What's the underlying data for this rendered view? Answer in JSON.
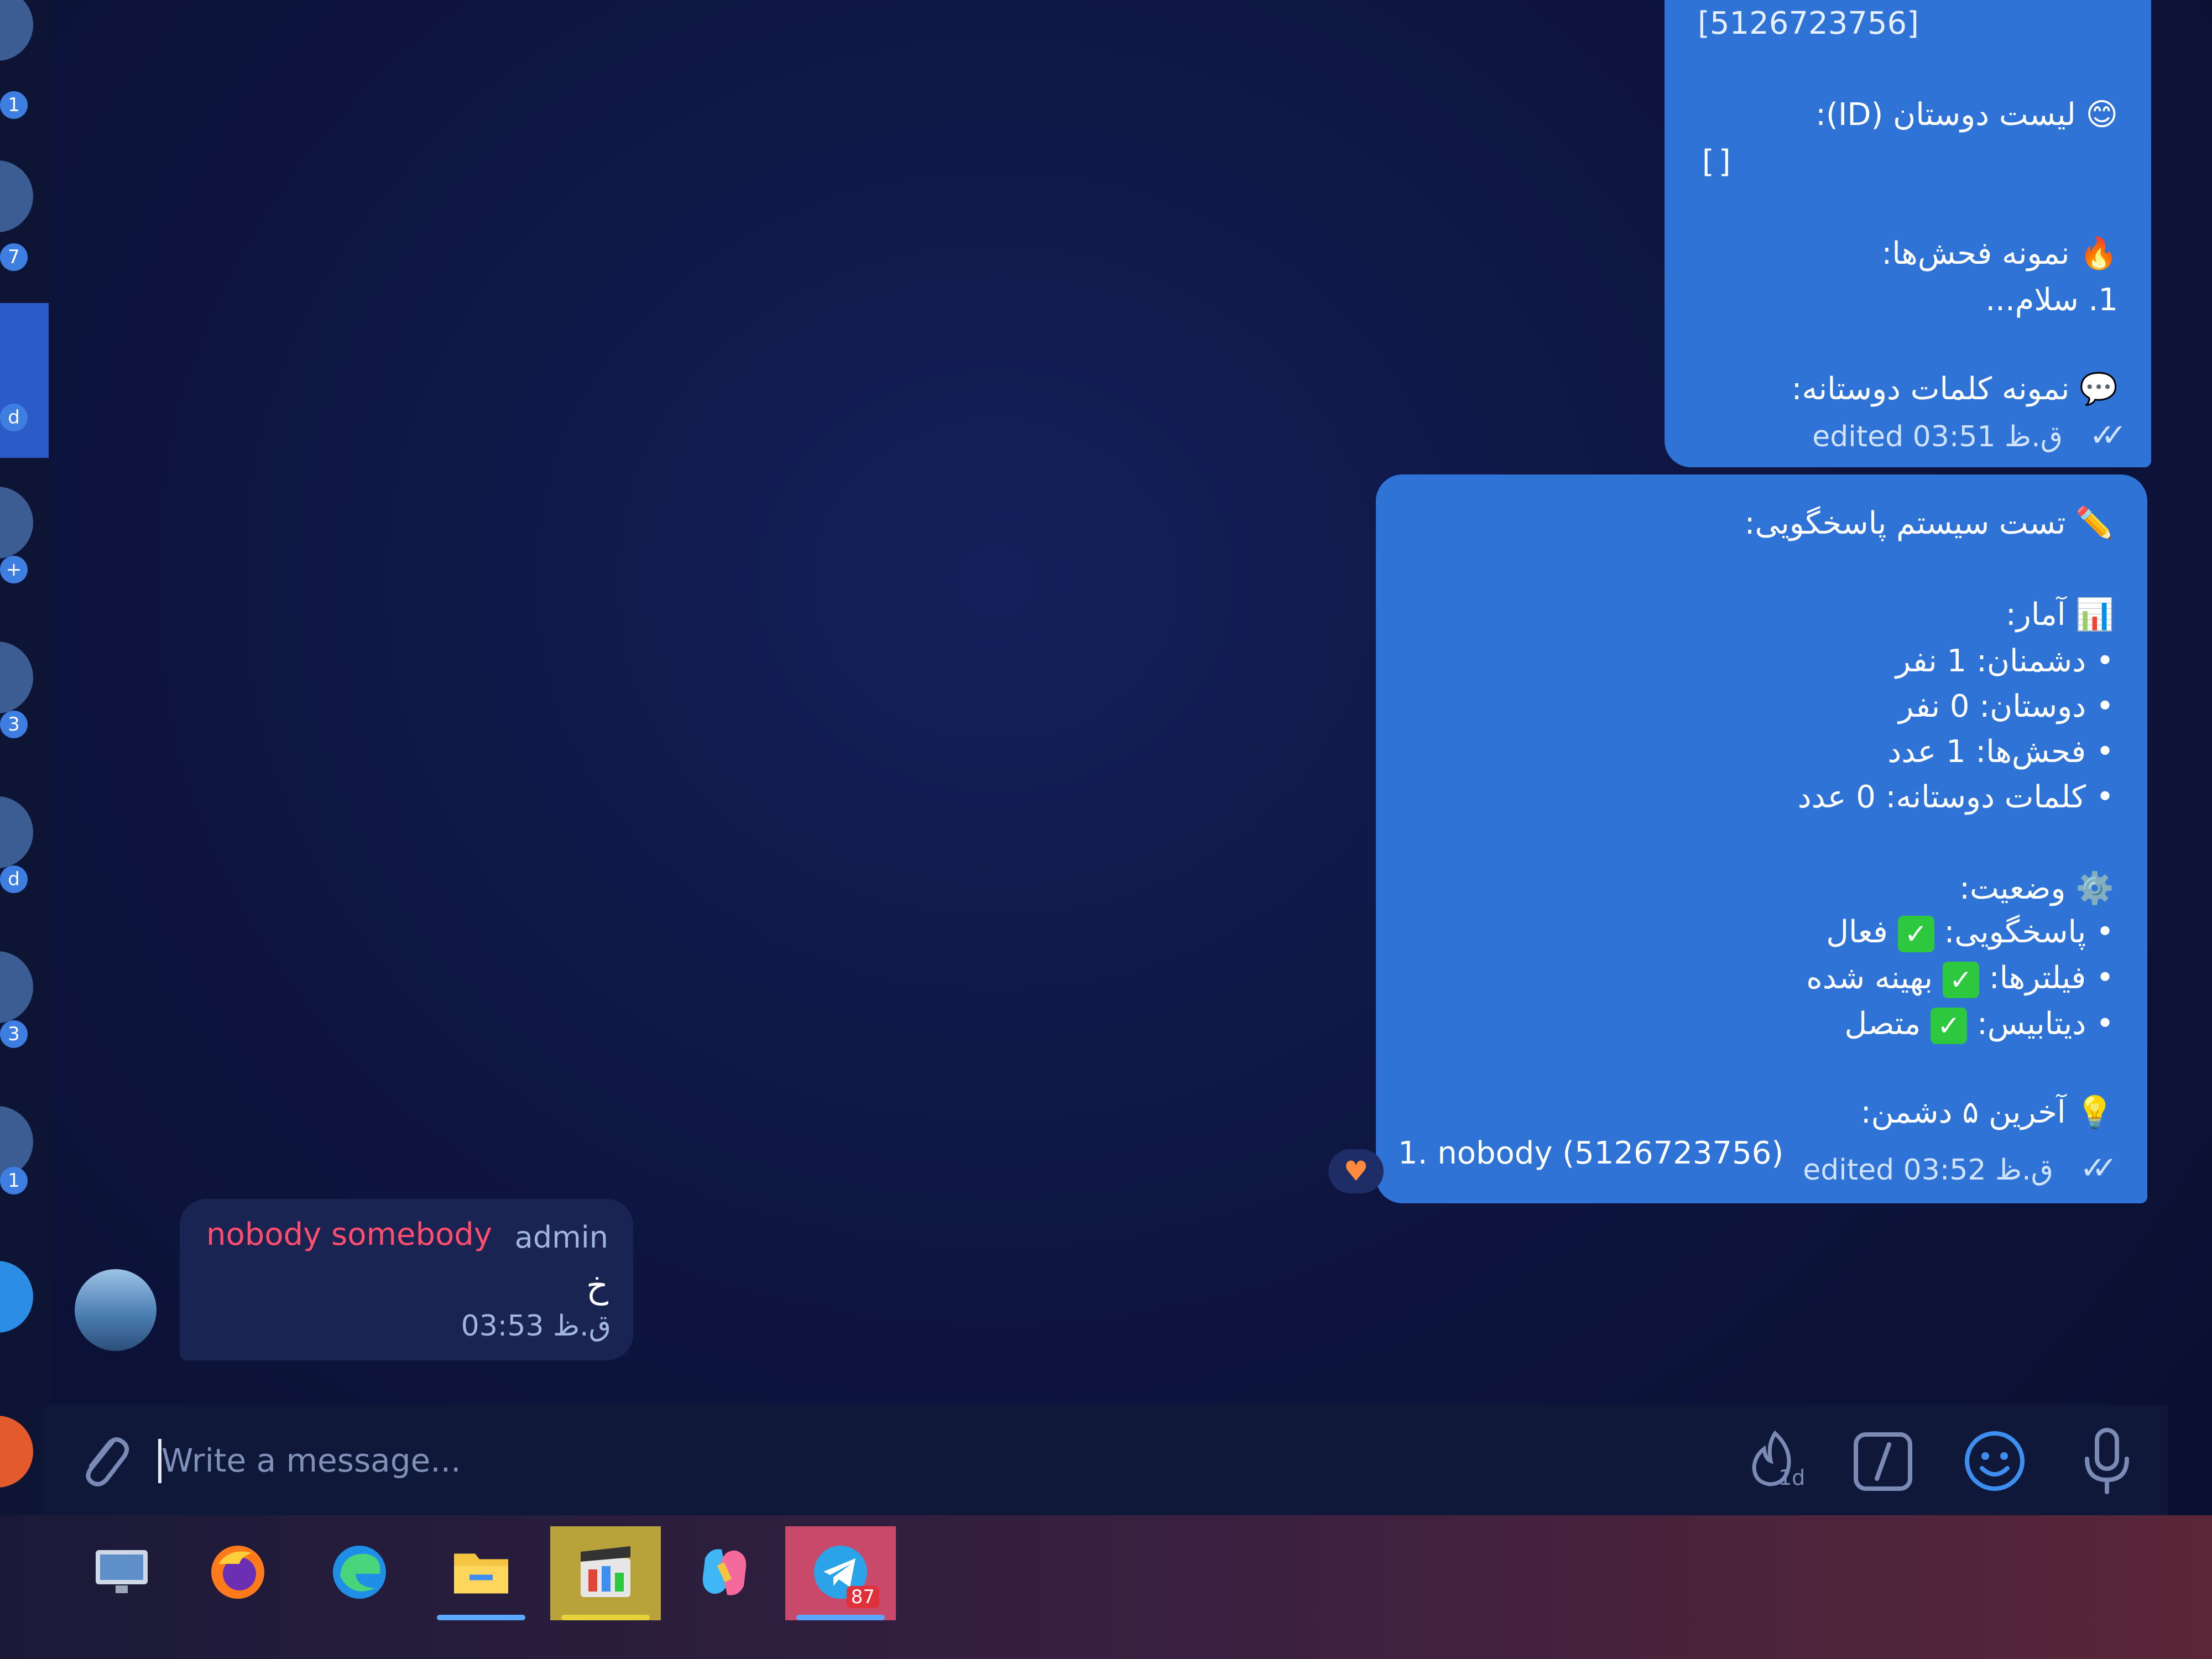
{
  "sidebar": {
    "badges": [
      "1",
      "7",
      "d",
      "+",
      "3",
      "d",
      "3",
      "1"
    ]
  },
  "messages": {
    "first": {
      "id_line": "[5126723756]",
      "friends_title": "لیست دوستان (ID):",
      "friends_value": "[]",
      "insults_title": "نمونه فحش‌ها:",
      "insults_item": "1. سلام...",
      "friendly_title": "نمونه کلمات دوستانه:",
      "meta": "edited 03:51 ق.ظ"
    },
    "second": {
      "title": "تست سیستم پاسخگویی:",
      "stats_title": "آمار:",
      "stats": [
        "• دشمنان: 1 نفر",
        "• دوستان: 0 نفر",
        "• فحش‌ها: 1 عدد",
        "• کلمات دوستانه: 0 عدد"
      ],
      "status_title": "وضعیت:",
      "status": [
        {
          "label": "• پاسخگویی:",
          "value": "فعال"
        },
        {
          "label": "• فیلترها:",
          "value": "بهینه شده"
        },
        {
          "label": "• دیتابیس:",
          "value": "متصل"
        }
      ],
      "enemies_title": "آخرین ۵ دشمن:",
      "enemy_1": "1. nobody (5126723756)",
      "meta": "edited 03:52 ق.ظ",
      "reaction": "♥"
    },
    "incoming": {
      "sender": "nobody somebody",
      "role": "admin",
      "text": "خ",
      "time": "03:53 ق.ظ"
    }
  },
  "composer": {
    "placeholder": "Write a message...",
    "timer_label": "1d"
  },
  "colors": {
    "bubble_out": "#2f73d6",
    "bubble_in": "#1a2452",
    "sender_name": "#ff4d6d",
    "check_green": "#2ec83f"
  },
  "taskbar": {
    "telegram_badge": "87"
  }
}
